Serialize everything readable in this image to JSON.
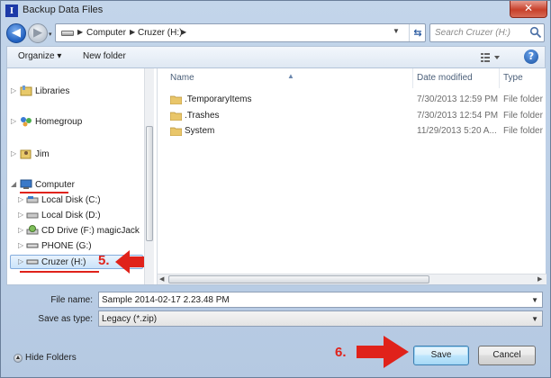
{
  "window": {
    "title": "Backup Data Files",
    "app_icon_letter": "I",
    "close_glyph": "✕"
  },
  "address": {
    "breadcrumb": [
      "Computer",
      "Cruzer (H:)"
    ],
    "search_placeholder": "Search Cruzer (H:)"
  },
  "toolbar": {
    "organize_label": "Organize ▾",
    "new_folder_label": "New folder",
    "help_glyph": "?"
  },
  "nav_tree": {
    "items": [
      {
        "label": "Libraries",
        "icon": "libraries-icon"
      },
      {
        "label": "Homegroup",
        "icon": "homegroup-icon"
      },
      {
        "label": "Jim",
        "icon": "user-folder-icon"
      },
      {
        "label": "Computer",
        "icon": "computer-icon"
      },
      {
        "label": "Local Disk (C:)",
        "icon": "hard-drive-icon"
      },
      {
        "label": "Local Disk (D:)",
        "icon": "hard-drive-icon"
      },
      {
        "label": "CD Drive (F:) magicJack",
        "icon": "cd-drive-icon"
      },
      {
        "label": "PHONE (G:)",
        "icon": "removable-drive-icon"
      },
      {
        "label": "Cruzer (H:)",
        "icon": "removable-drive-icon"
      }
    ],
    "selected": "Cruzer (H:)"
  },
  "annotations": {
    "step5": "5.",
    "step6": "6.",
    "accent_color": "#e0221a"
  },
  "file_list": {
    "columns": [
      "Name",
      "Date modified",
      "Type"
    ],
    "rows": [
      {
        "name": ".TemporaryItems",
        "date": "7/30/2013 12:59 PM",
        "type": "File folder"
      },
      {
        "name": ".Trashes",
        "date": "7/30/2013 12:54 PM",
        "type": "File folder"
      },
      {
        "name": "System",
        "date": "11/29/2013 5:20 A...",
        "type": "File folder"
      }
    ]
  },
  "form": {
    "file_name_label": "File name:",
    "file_name_value": "Sample 2014-02-17 2.23.48 PM",
    "save_type_label": "Save as type:",
    "save_type_value": "Legacy (*.zip)"
  },
  "footer": {
    "hide_folders_label": "Hide Folders",
    "save_label": "Save",
    "cancel_label": "Cancel"
  }
}
